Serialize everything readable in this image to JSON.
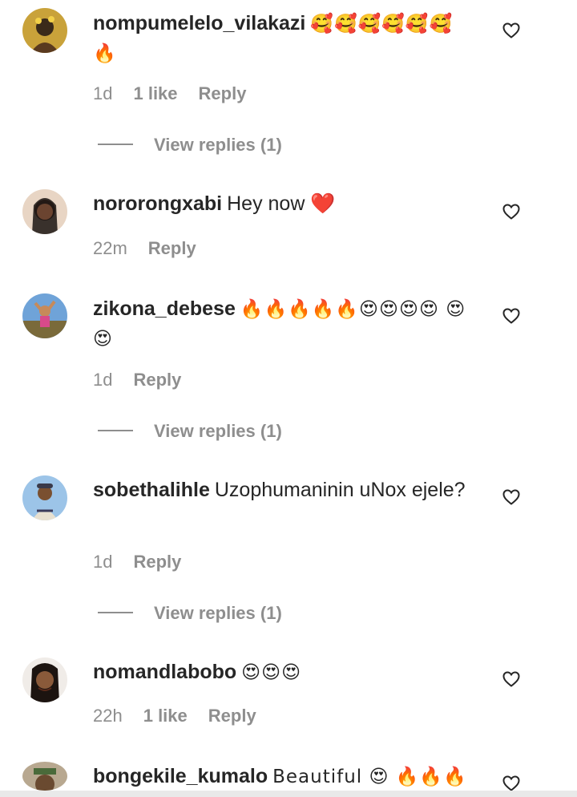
{
  "comments": [
    {
      "username": "nompumelelo_vilakazi",
      "text": "🥰🥰🥰🥰🥰🥰 🔥",
      "time": "1d",
      "likes": "1 like",
      "reply": "Reply",
      "view_replies": "View replies (1)"
    },
    {
      "username": "nororongxabi",
      "text": "Hey now ❤️",
      "time": "22m",
      "reply": "Reply"
    },
    {
      "username": "zikona_debese",
      "text": "🔥🔥🔥🔥🔥😍😍😍😍 😍😍",
      "time": "1d",
      "reply": "Reply",
      "view_replies": "View replies (1)"
    },
    {
      "username": "sobethalihle",
      "text": "Uzophumaninin uNox ejele?",
      "time": "1d",
      "reply": "Reply",
      "view_replies": "View replies (1)"
    },
    {
      "username": "nomandlabobo",
      "text": "😍😍😍",
      "time": "22h",
      "likes": "1 like",
      "reply": "Reply"
    },
    {
      "username": "bongekile_kumalo",
      "text": "Beautiful 😍 🔥🔥🔥"
    }
  ],
  "colors": {
    "text": "#262626",
    "secondary": "#8e8e8e",
    "background": "#ffffff"
  }
}
